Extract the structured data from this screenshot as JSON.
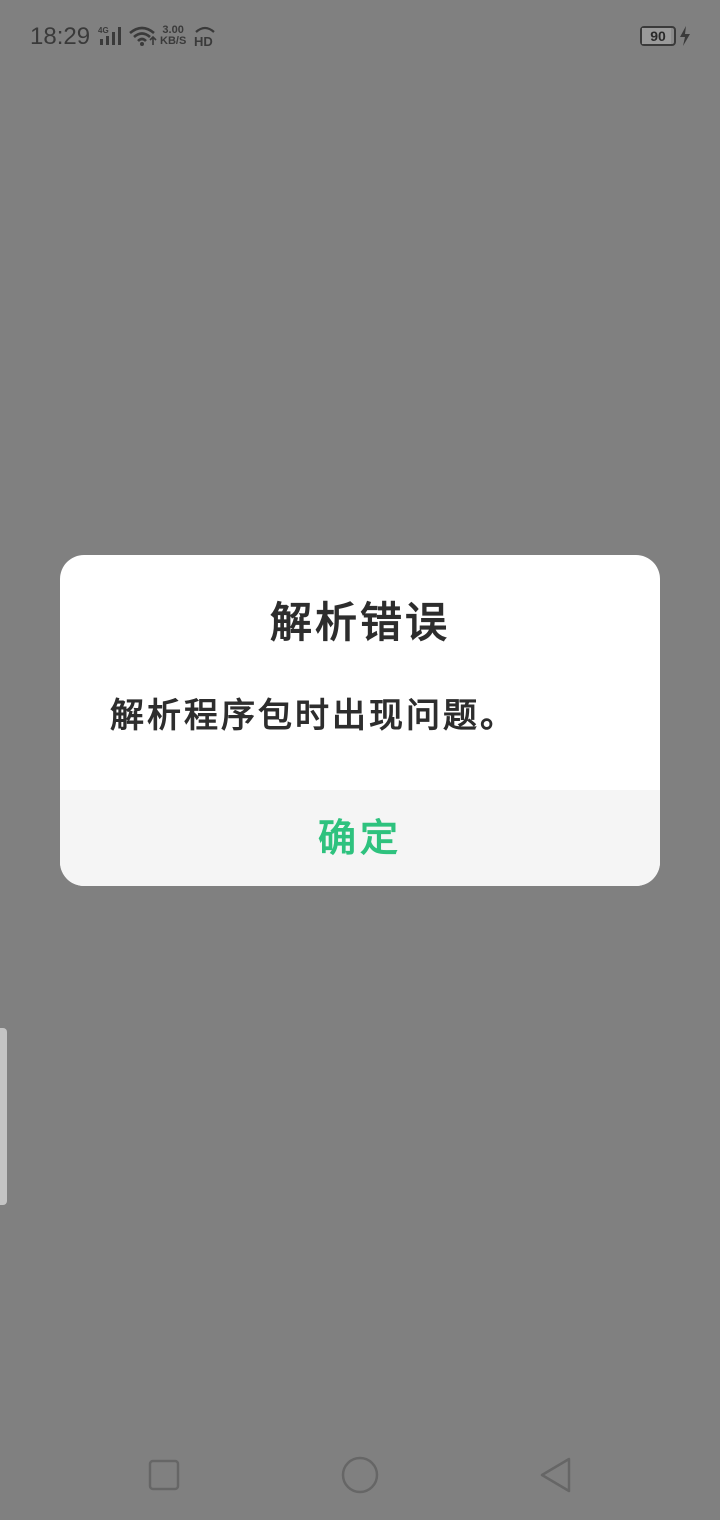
{
  "status_bar": {
    "time": "18:29",
    "network_type": "4G",
    "speed_value": "3.00",
    "speed_unit": "KB/S",
    "hd_label": "HD",
    "battery_level": "90",
    "battery_fraction": 0.9
  },
  "dialog": {
    "title": "解析错误",
    "message": "解析程序包时出现问题。",
    "confirm_label": "确定",
    "confirm_color": "#2ec27e"
  },
  "nav_bar": {
    "icons": [
      "recent-apps-icon",
      "home-icon",
      "back-icon"
    ]
  }
}
